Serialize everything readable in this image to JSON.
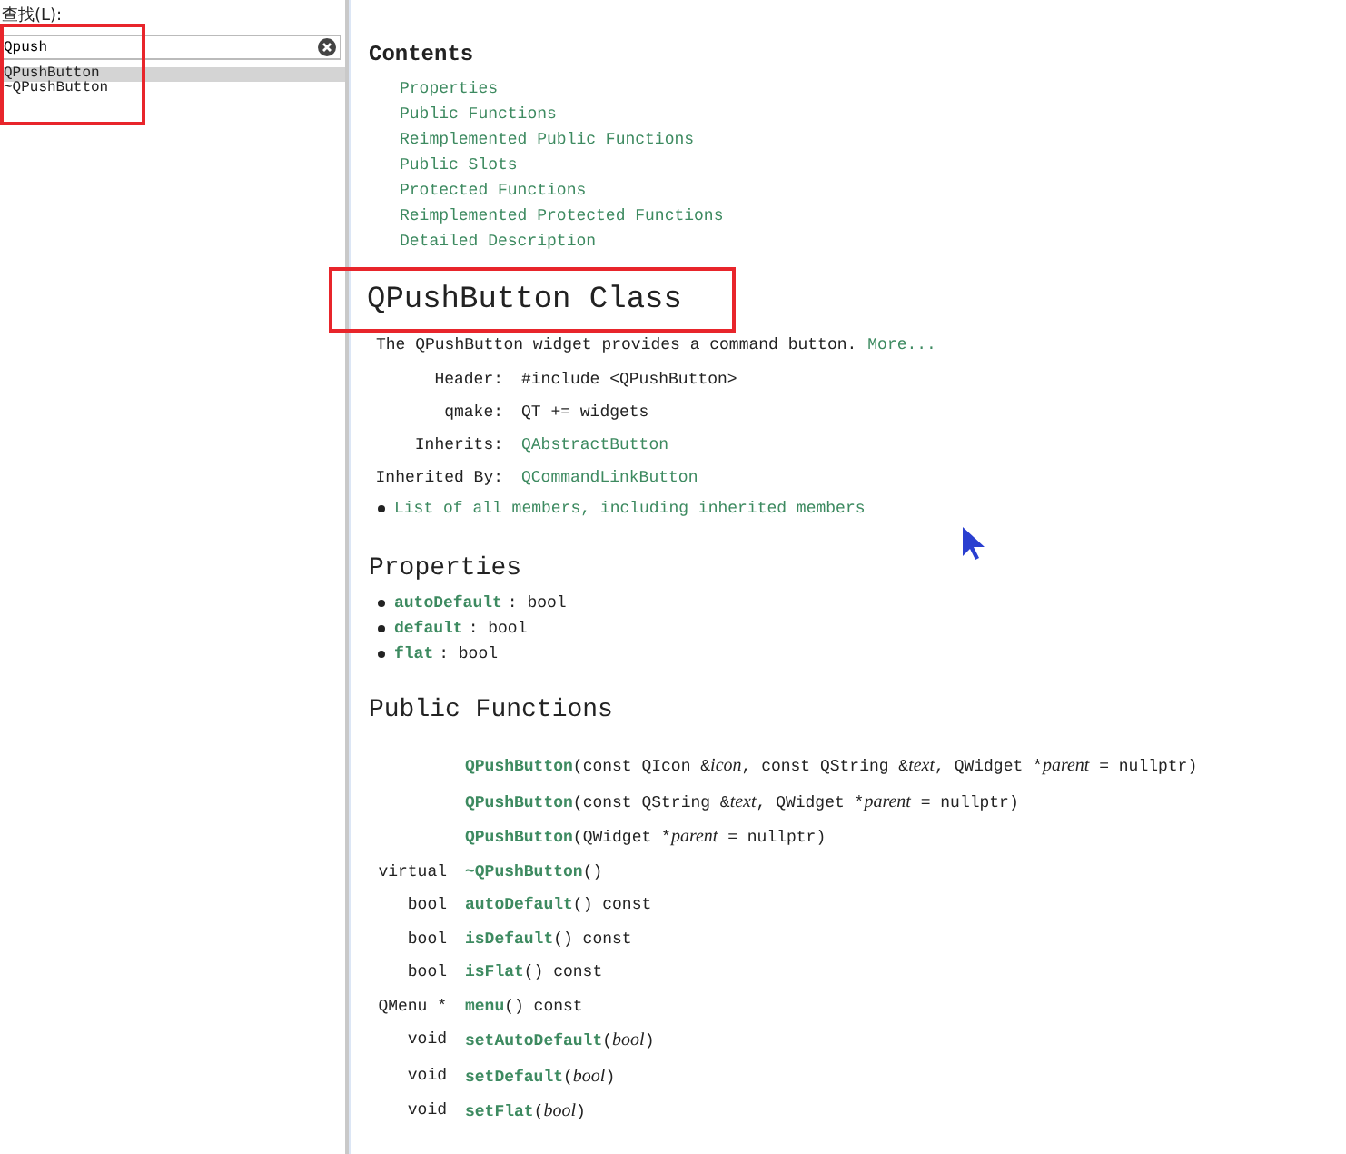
{
  "index_panel": {
    "find_label": "查找(L):",
    "search": {
      "value": "Qpush"
    },
    "items": [
      {
        "label": "QPushButton",
        "selected": true
      },
      {
        "label": "~QPushButton",
        "selected": false
      }
    ]
  },
  "contents": {
    "title": "Contents",
    "links": [
      "Properties",
      "Public Functions",
      "Reimplemented Public Functions",
      "Public Slots",
      "Protected Functions",
      "Reimplemented Protected Functions",
      "Detailed Description"
    ]
  },
  "class_title": "QPushButton Class",
  "brief": {
    "text": "The QPushButton widget provides a command button.",
    "more": "More..."
  },
  "info": [
    {
      "label": "Header:",
      "value": "#include <QPushButton>",
      "kind": "text"
    },
    {
      "label": "qmake:",
      "value": "QT += widgets",
      "kind": "text"
    },
    {
      "label": "Inherits:",
      "value": "QAbstractButton",
      "kind": "link"
    },
    {
      "label": "Inherited By:",
      "value": "QCommandLinkButton",
      "kind": "link"
    }
  ],
  "all_members_link": "List of all members, including inherited members",
  "properties": {
    "title": "Properties",
    "items": [
      {
        "name": "autoDefault",
        "type": ": bool"
      },
      {
        "name": "default",
        "type": ": bool"
      },
      {
        "name": "flat",
        "type": ": bool"
      }
    ]
  },
  "public_functions": {
    "title": "Public Functions",
    "rows": [
      {
        "name": "QPushButton",
        "params": [
          {
            "text": "(const QIcon &",
            "italic": false
          },
          {
            "text": "icon",
            "italic": true
          },
          {
            "text": ", const QString &",
            "italic": false
          },
          {
            "text": "text",
            "italic": true
          },
          {
            "text": ", QWidget *",
            "italic": false
          },
          {
            "text": "parent",
            "italic": true
          },
          {
            "text": " = nullptr)",
            "italic": false
          }
        ]
      },
      {
        "name": "QPushButton",
        "params": [
          {
            "text": "(const QString &",
            "italic": false
          },
          {
            "text": "text",
            "italic": true
          },
          {
            "text": ", QWidget *",
            "italic": false
          },
          {
            "text": "parent",
            "italic": true
          },
          {
            "text": " = nullptr)",
            "italic": false
          }
        ]
      },
      {
        "name": "QPushButton",
        "params": [
          {
            "text": "(QWidget *",
            "italic": false
          },
          {
            "text": "parent",
            "italic": true
          },
          {
            "text": " = nullptr)",
            "italic": false
          }
        ]
      },
      {
        "return": "virtual",
        "name": "~QPushButton",
        "params": [
          {
            "text": "()",
            "italic": false
          }
        ]
      },
      {
        "return": "bool",
        "name": "autoDefault",
        "params": [
          {
            "text": "() const",
            "italic": false
          }
        ]
      },
      {
        "return": "bool",
        "name": "isDefault",
        "params": [
          {
            "text": "() const",
            "italic": false
          }
        ]
      },
      {
        "return": "bool",
        "name": "isFlat",
        "params": [
          {
            "text": "() const",
            "italic": false
          }
        ]
      },
      {
        "return": "QMenu *",
        "name": "menu",
        "params": [
          {
            "text": "() const",
            "italic": false
          }
        ]
      },
      {
        "return": "void",
        "name": "setAutoDefault",
        "params": [
          {
            "text": "(",
            "italic": false
          },
          {
            "text": "bool",
            "italic": true
          },
          {
            "text": ")",
            "italic": false
          }
        ]
      },
      {
        "return": "void",
        "name": "setDefault",
        "params": [
          {
            "text": "(",
            "italic": false
          },
          {
            "text": "bool",
            "italic": true
          },
          {
            "text": ")",
            "italic": false
          }
        ]
      },
      {
        "return": "void",
        "name": "setFlat",
        "params": [
          {
            "text": "(",
            "italic": false
          },
          {
            "text": "bool",
            "italic": true
          },
          {
            "text": ")",
            "italic": false
          }
        ]
      }
    ]
  }
}
